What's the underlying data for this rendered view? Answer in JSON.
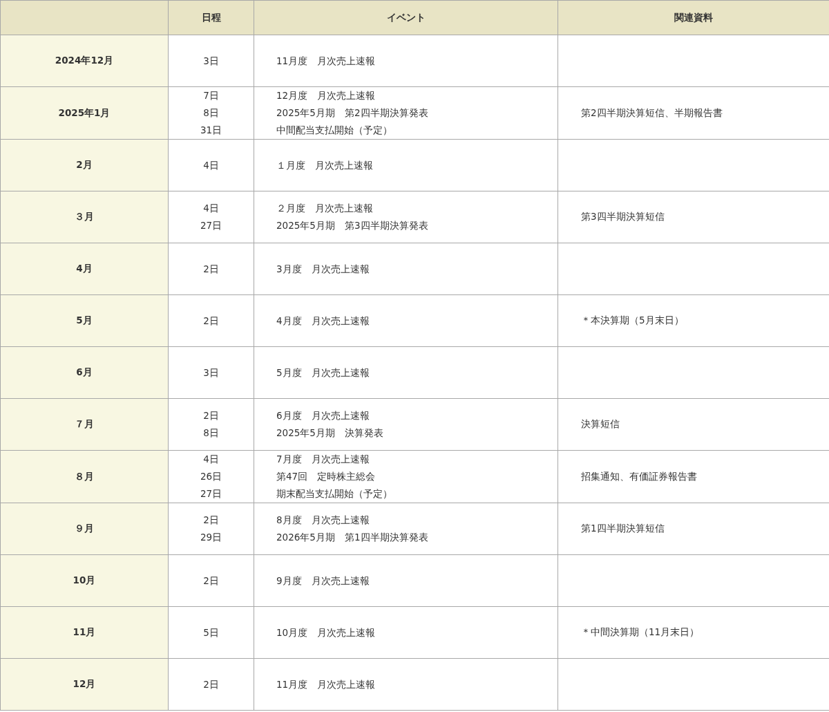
{
  "table": {
    "columns": [
      "",
      "日程",
      "イベント",
      "関連資料"
    ],
    "rows": [
      {
        "month": "2024年12月",
        "dates": [
          "3日"
        ],
        "events": [
          "11月度　月次売上速報"
        ],
        "documents": ""
      },
      {
        "month": "2025年1月",
        "dates": [
          "7日",
          "8日",
          "31日"
        ],
        "events": [
          "12月度　月次売上速報",
          "2025年5月期　第2四半期決算発表",
          "中間配当支払開始（予定）"
        ],
        "documents": "第2四半期決算短信、半期報告書"
      },
      {
        "month": "2月",
        "dates": [
          "4日"
        ],
        "events": [
          "１月度　月次売上速報"
        ],
        "documents": ""
      },
      {
        "month": "３月",
        "dates": [
          "4日",
          "27日"
        ],
        "events": [
          "２月度　月次売上速報",
          "2025年5月期　第3四半期決算発表"
        ],
        "documents": "第3四半期決算短信"
      },
      {
        "month": "4月",
        "dates": [
          "2日"
        ],
        "events": [
          "3月度　月次売上速報"
        ],
        "documents": ""
      },
      {
        "month": "5月",
        "dates": [
          "2日"
        ],
        "events": [
          "4月度　月次売上速報"
        ],
        "documents": "＊本決算期（5月末日）"
      },
      {
        "month": "6月",
        "dates": [
          "3日"
        ],
        "events": [
          "5月度　月次売上速報"
        ],
        "documents": ""
      },
      {
        "month": "７月",
        "dates": [
          "2日",
          "8日"
        ],
        "events": [
          "6月度　月次売上速報",
          "2025年5月期　決算発表"
        ],
        "documents": "決算短信"
      },
      {
        "month": "８月",
        "dates": [
          "4日",
          "26日",
          "27日"
        ],
        "events": [
          "7月度　月次売上速報",
          "第47回　定時株主総会",
          "期末配当支払開始（予定）"
        ],
        "documents": "招集通知、有価証券報告書"
      },
      {
        "month": "９月",
        "dates": [
          "2日",
          "29日"
        ],
        "events": [
          "8月度　月次売上速報",
          "2026年5月期　第1四半期決算発表"
        ],
        "documents": "第1四半期決算短信"
      },
      {
        "month": "10月",
        "dates": [
          "2日"
        ],
        "events": [
          "9月度　月次売上速報"
        ],
        "documents": ""
      },
      {
        "month": "11月",
        "dates": [
          "5日"
        ],
        "events": [
          "10月度　月次売上速報"
        ],
        "documents": "＊中間決算期（11月末日）"
      },
      {
        "month": "12月",
        "dates": [
          "2日"
        ],
        "events": [
          "11月度　月次売上速報"
        ],
        "documents": ""
      }
    ]
  }
}
